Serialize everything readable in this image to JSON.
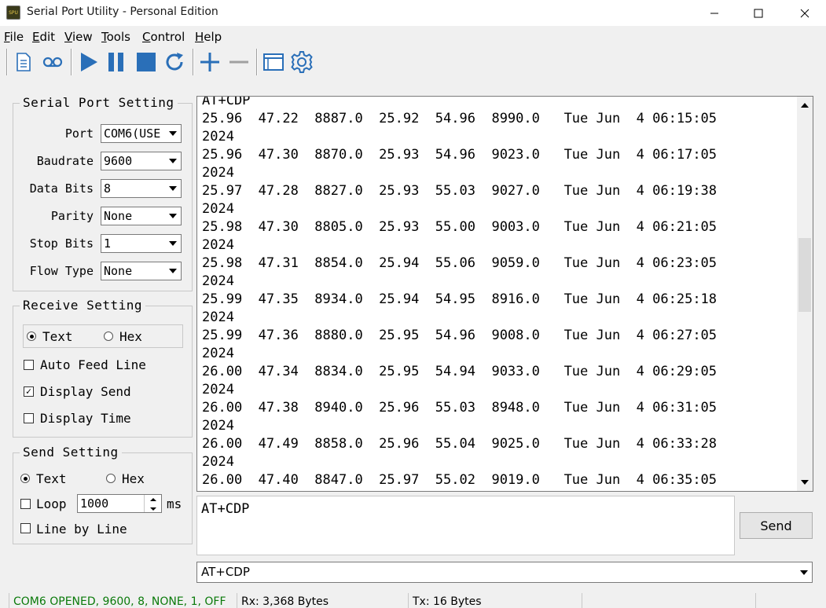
{
  "window": {
    "title": "Serial Port Utility - Personal Edition",
    "icon_text": "SPU"
  },
  "menu": [
    {
      "key": "F",
      "rest": "ile"
    },
    {
      "key": "E",
      "rest": "dit"
    },
    {
      "key": "V",
      "rest": "iew"
    },
    {
      "key": "T",
      "rest": "ools"
    },
    {
      "key": "C",
      "rest": "ontrol"
    },
    {
      "key": "H",
      "rest": "elp"
    }
  ],
  "toolbar": {
    "icons": [
      "document-icon",
      "record-icon",
      "play-icon",
      "pause-icon",
      "stop-icon",
      "refresh-icon",
      "plus-icon",
      "minus-icon",
      "window-icon",
      "settings-gear-icon"
    ],
    "accent": "#2a6fb8"
  },
  "serial_port_setting": {
    "title": "Serial Port Setting",
    "port_label": "Port",
    "port_value": "COM6(USE",
    "baudrate_label": "Baudrate",
    "baudrate_value": "9600",
    "data_bits_label": "Data Bits",
    "data_bits_value": "8",
    "parity_label": "Parity",
    "parity_value": "None",
    "stop_bits_label": "Stop Bits",
    "stop_bits_value": "1",
    "flow_type_label": "Flow Type",
    "flow_type_value": "None"
  },
  "receive_setting": {
    "title": "Receive Setting",
    "text_label": "Text",
    "hex_label": "Hex",
    "selected": "Text",
    "auto_feed_line_label": "Auto Feed Line",
    "auto_feed_line_checked": false,
    "display_send_label": "Display Send",
    "display_send_checked": true,
    "display_time_label": "Display Time",
    "display_time_checked": false
  },
  "send_setting": {
    "title": "Send Setting",
    "text_label": "Text",
    "hex_label": "Hex",
    "selected": "Text",
    "loop_label": "Loop",
    "loop_checked": false,
    "loop_interval": "1000",
    "loop_unit": "ms",
    "line_by_line_label": "Line by Line",
    "line_by_line_checked": false
  },
  "receive_lines": [
    "AT+CDP",
    "25.96  47.22  8887.0  25.92  54.96  8990.0   Tue Jun  4 06:15:05",
    "2024",
    "25.96  47.30  8870.0  25.93  54.96  9023.0   Tue Jun  4 06:17:05",
    "2024",
    "25.97  47.28  8827.0  25.93  55.03  9027.0   Tue Jun  4 06:19:38",
    "2024",
    "25.98  47.30  8805.0  25.93  55.00  9003.0   Tue Jun  4 06:21:05",
    "2024",
    "25.98  47.31  8854.0  25.94  55.06  9059.0   Tue Jun  4 06:23:05",
    "2024",
    "25.99  47.35  8934.0  25.94  54.95  8916.0   Tue Jun  4 06:25:18",
    "2024",
    "25.99  47.36  8880.0  25.95  54.96  9008.0   Tue Jun  4 06:27:05",
    "2024",
    "26.00  47.34  8834.0  25.95  54.94  9033.0   Tue Jun  4 06:29:05",
    "2024",
    "26.00  47.38  8940.0  25.96  55.03  8948.0   Tue Jun  4 06:31:05",
    "2024",
    "26.00  47.49  8858.0  25.96  55.04  9025.0   Tue Jun  4 06:33:28",
    "2024",
    "26.00  47.40  8847.0  25.97  55.02  9019.0   Tue Jun  4 06:35:05"
  ],
  "send": {
    "text": "AT+CDP",
    "button_label": "Send",
    "history_value": "AT+CDP"
  },
  "status": {
    "connection": "COM6 OPENED, 9600, 8, NONE, 1, OFF",
    "connection_color": "#0a7a0a",
    "rx": "Rx: 3,368 Bytes",
    "tx": "Tx: 16 Bytes"
  }
}
